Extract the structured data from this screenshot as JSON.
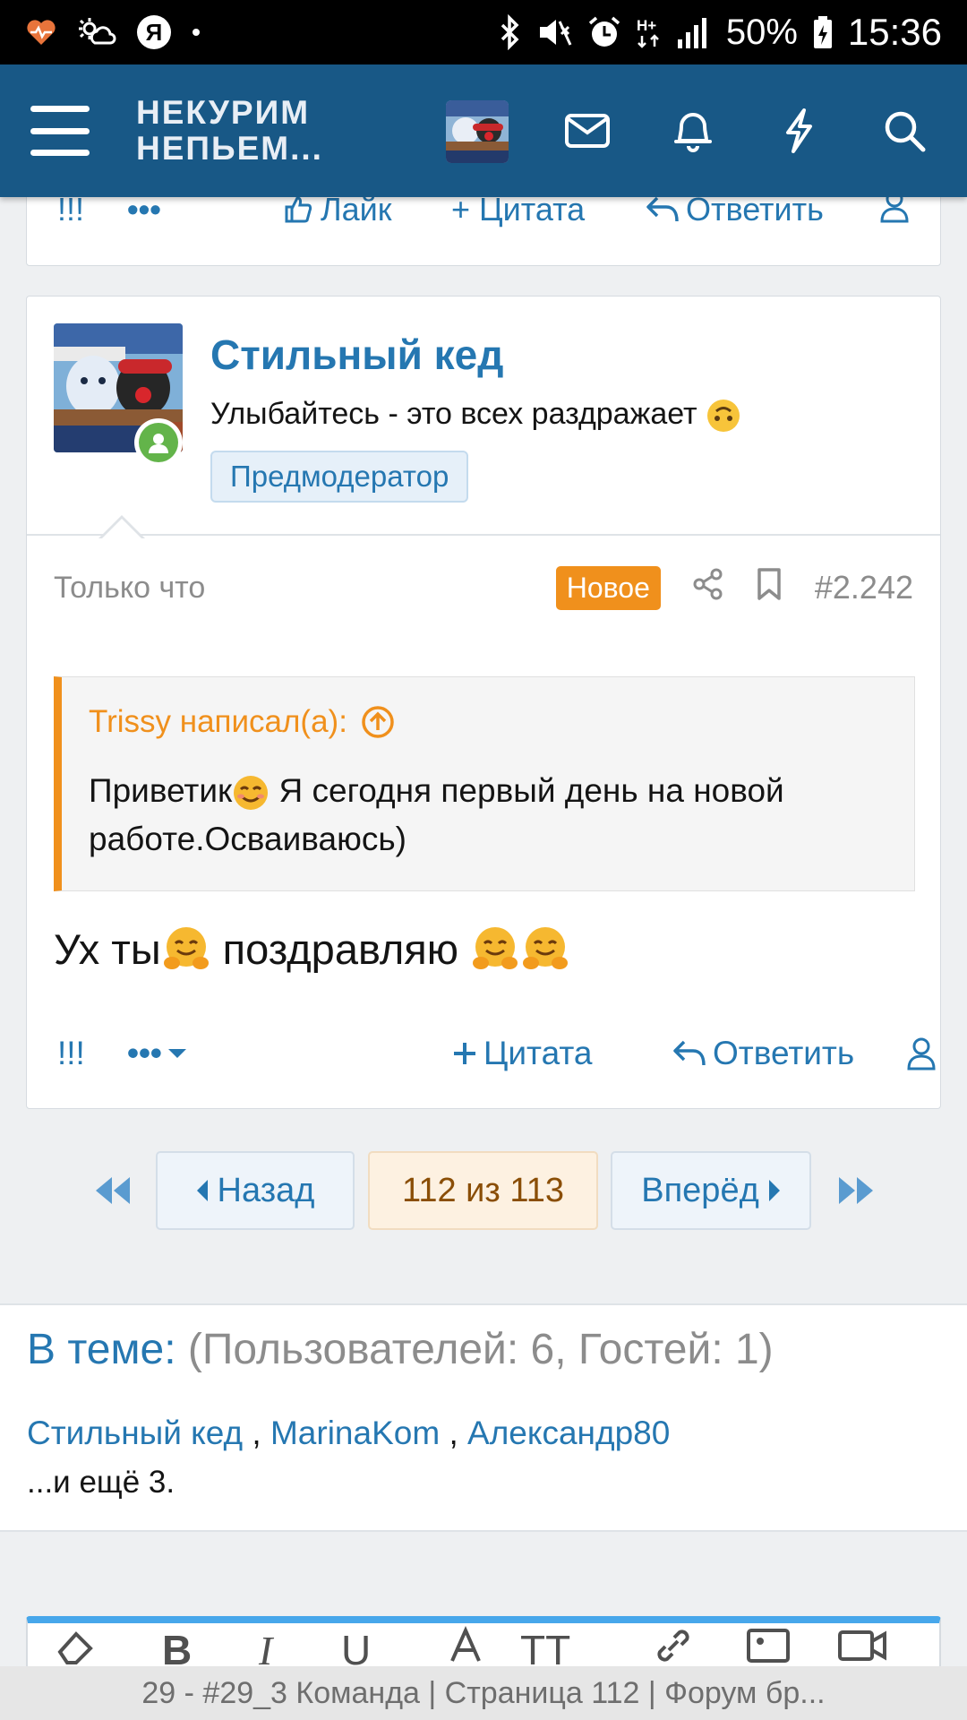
{
  "status_bar": {
    "battery": "50%",
    "time": "15:36",
    "yandex_letter": "Я"
  },
  "header": {
    "logo_line1": "НЕКУРИМ",
    "logo_line2": "НЕПЬЕМ..."
  },
  "prev_post": {
    "like_label": "Лайк",
    "quote_label": "Цитата",
    "reply_label": "Ответить",
    "report_label": "!!!"
  },
  "post": {
    "username": "Стильный кед",
    "user_title": "Улыбайтесь - это всех раздражает",
    "role": "Предмодератор",
    "time": "Только что",
    "new_badge": "Новое",
    "post_number": "#2.242",
    "quote": {
      "author": "Trissy написал(а):",
      "text_part1": "Приветик",
      "text_part2": " Я сегодня первый день на новой работе.Осваиваюсь)"
    },
    "message_part1": "Ух ты",
    "message_part2": " поздравляю ",
    "actions": {
      "report": "!!!",
      "quote": "Цитата",
      "reply": "Ответить"
    }
  },
  "pagination": {
    "prev": "Назад",
    "current": "112 из 113",
    "next": "Вперёд"
  },
  "online": {
    "title": "В теме:",
    "stats": "(Пользователей: 6, Гостей: 1)",
    "users": [
      "Стильный кед",
      "MarinaKom",
      "Александр80"
    ],
    "separator": " , ",
    "more": "...и ещё 3."
  },
  "bottom_bar": {
    "title": "29 - #29_3 Команда | Страница 112 | Форум бр..."
  },
  "colors": {
    "brand": "#185886",
    "link": "#2577b1",
    "accent": "#f0901c",
    "online": "#63b44a"
  }
}
